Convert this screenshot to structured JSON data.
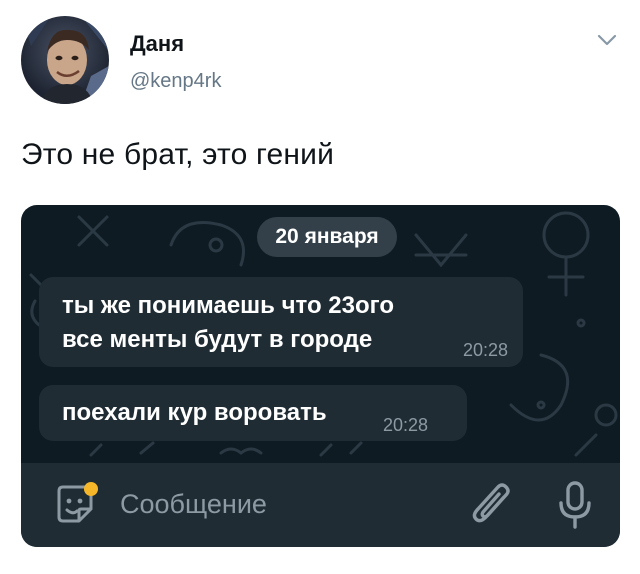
{
  "tweet": {
    "author_name": "Даня",
    "author_handle": "@kenp4rk",
    "text": "Это не брат, это гений"
  },
  "chat": {
    "date_label": "20 января",
    "messages": [
      {
        "lines": [
          "ты же понимаешь что 23ого",
          "все менты будут в городе"
        ],
        "time": "20:28"
      },
      {
        "lines": [
          "поехали кур воровать"
        ],
        "time": "20:28"
      }
    ],
    "composer_placeholder": "Сообщение"
  },
  "colors": {
    "chat_background": "#0f1b22",
    "bubble": "#1f2c34",
    "secondary_text": "#8d9aa4",
    "handle_gray": "#657786",
    "sticker_dot": "#f5b62a"
  },
  "icons": [
    "caret-down-icon",
    "sticker-icon",
    "paperclip-icon",
    "microphone-icon"
  ]
}
